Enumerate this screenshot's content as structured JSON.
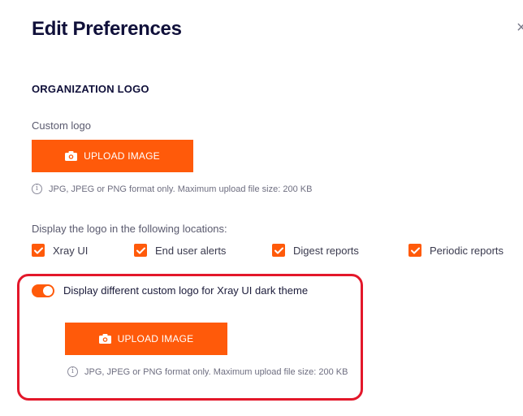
{
  "dialog": {
    "title": "Edit Preferences",
    "close_glyph": "×"
  },
  "organization_logo": {
    "section_title": "ORGANIZATION LOGO",
    "custom_logo_label": "Custom logo",
    "upload_button_label": "UPLOAD IMAGE",
    "upload_hint": "JPG, JPEG or PNG format only. Maximum upload file size: 200 KB",
    "locations_label": "Display the logo in the following locations:",
    "locations": [
      {
        "label": "Xray UI",
        "checked": true
      },
      {
        "label": "End user alerts",
        "checked": true
      },
      {
        "label": "Digest reports",
        "checked": true
      },
      {
        "label": "Periodic reports",
        "checked": true
      }
    ]
  },
  "dark_theme_logo": {
    "toggle_label": "Display different custom logo for Xray UI dark theme",
    "toggle_on": true,
    "upload_button_label": "UPLOAD IMAGE",
    "upload_hint": "JPG, JPEG or PNG format only. Maximum upload file size: 200 KB"
  },
  "colors": {
    "accent": "#ff5a0a",
    "highlight_border": "#e3172a",
    "title_text": "#10103a"
  },
  "icons": {
    "camera": "camera-icon",
    "info": "info-icon",
    "check": "check-icon",
    "close": "close-icon"
  }
}
